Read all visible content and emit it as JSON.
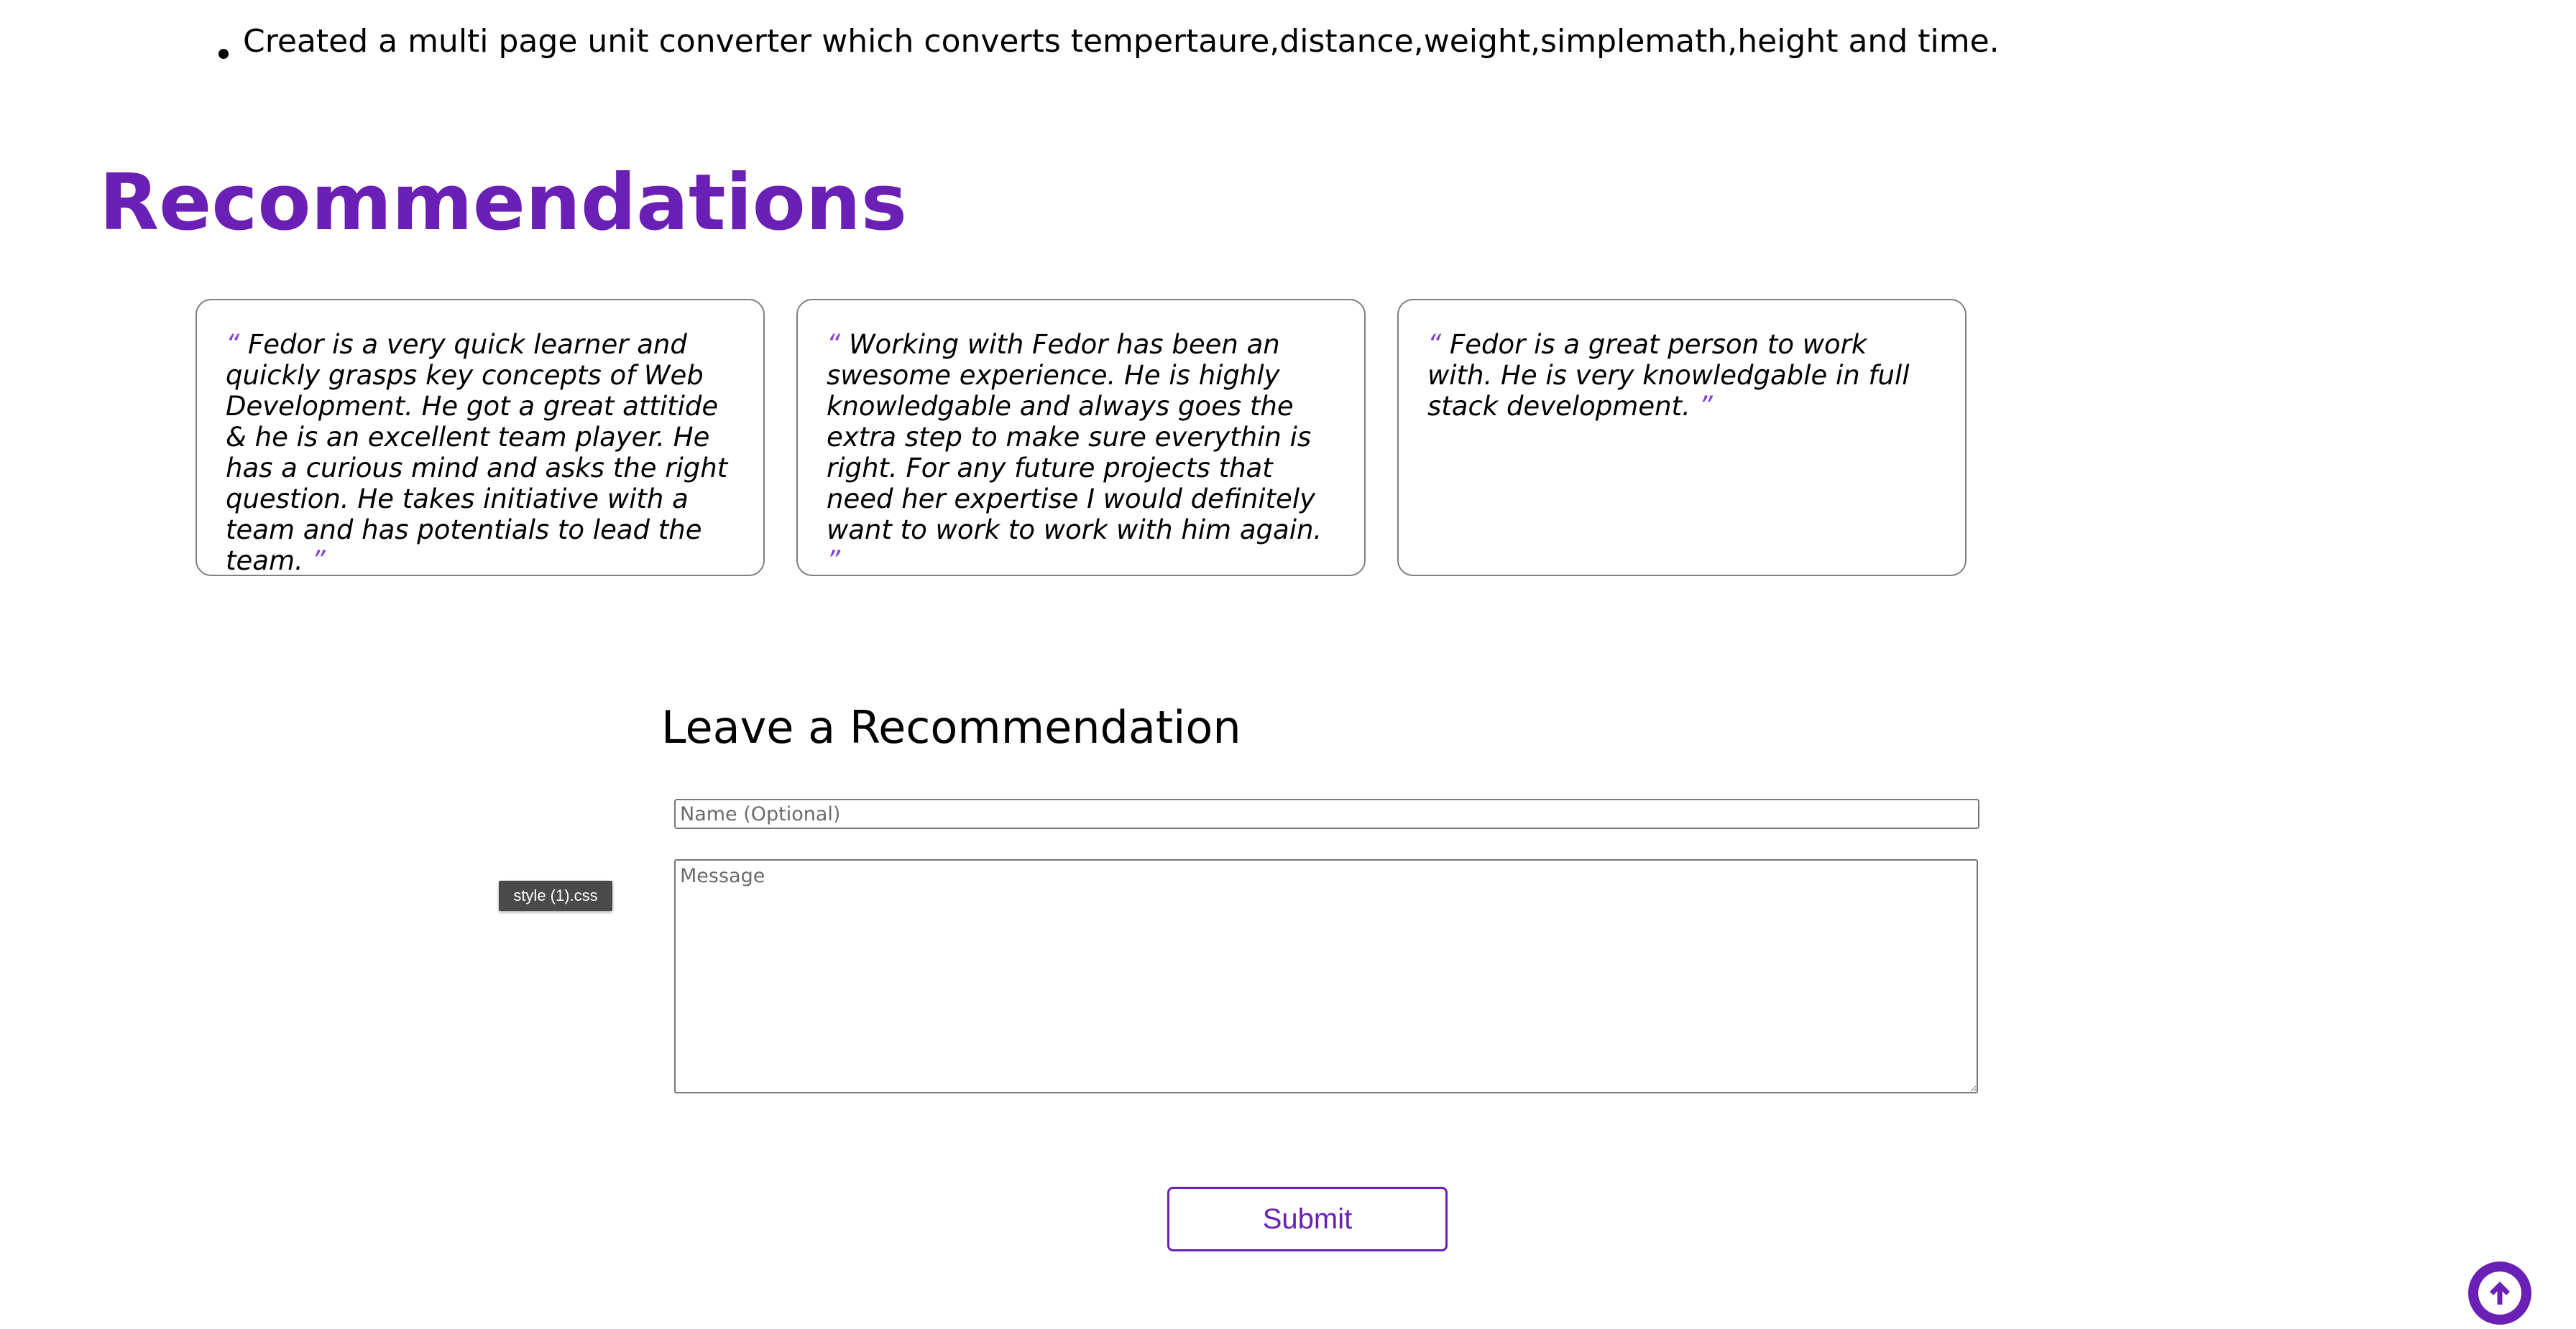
{
  "projects": {
    "items": [
      "Created a multi page unit converter which converts tempertaure,distance,weight,simplemath,height and time."
    ]
  },
  "recommendations": {
    "title": "Recommendations",
    "open_quote": "“",
    "close_quote": "”",
    "cards": [
      {
        "text": "Fedor is a very quick learner and quickly grasps key concepts of Web Development. He got a great attitide & he is an excellent team player. He has a curious mind and asks the right question. He takes initiative with a team and has potentials to lead the team."
      },
      {
        "text": "Working with Fedor has been an swesome experience. He is highly knowledgable and always goes the extra step to make sure everythin is right. For any future projects that need her expertise I would definitely want to work to work with him again."
      },
      {
        "text": "Fedor is a great person to work with. He is very knowledgable in full stack development."
      }
    ]
  },
  "form": {
    "title": "Leave a Recommendation",
    "name_placeholder": "Name (Optional)",
    "message_placeholder": "Message",
    "submit_label": "Submit"
  },
  "tooltip": {
    "text": "style (1).css"
  },
  "colors": {
    "accent": "#6a1fb5",
    "card_border": "#7f7f7f"
  },
  "icons": {
    "top_button": "arrow-up-icon"
  }
}
